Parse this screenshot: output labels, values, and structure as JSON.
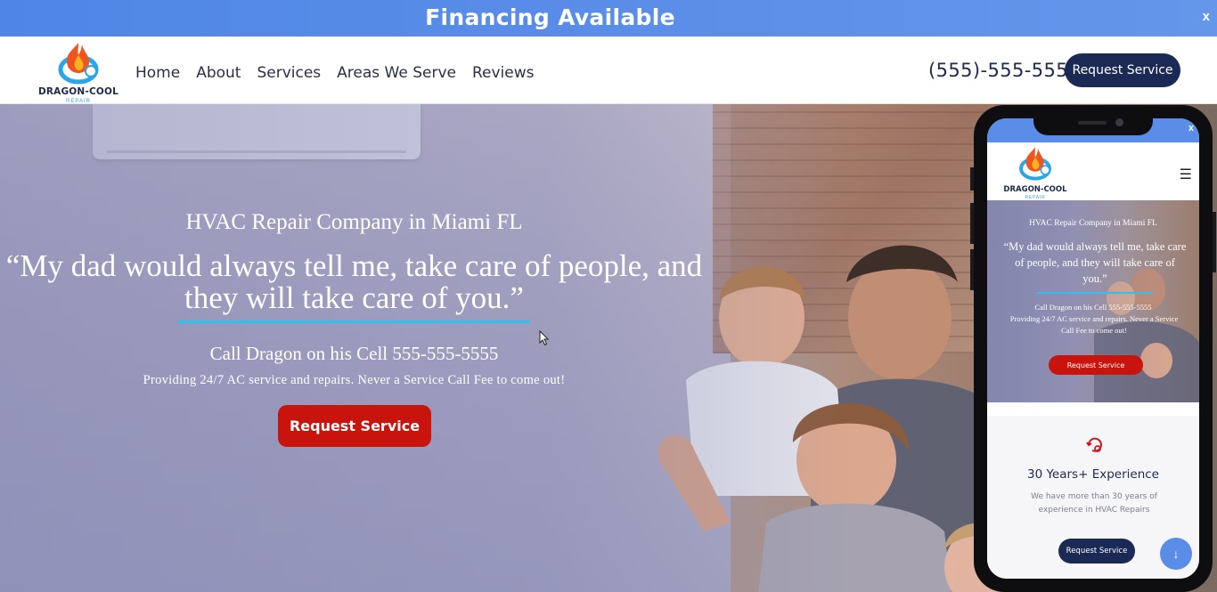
{
  "banner": {
    "text": "Financing Available",
    "close_label": "x"
  },
  "header": {
    "logo": {
      "name": "DRAGON-COOL",
      "sub": "REPAIR"
    },
    "nav": [
      "Home",
      "About",
      "Services",
      "Areas We Serve",
      "Reviews"
    ],
    "phone": "(555)-555-555",
    "request_button": "Request Service"
  },
  "hero": {
    "subtitle": "HVAC Repair Company in Miami FL",
    "quote": "“My dad would always tell me, take care of people, and they will take care of you.”",
    "call": "Call Dragon on his Cell 555-555-5555",
    "providing": "Providing 24/7 AC service and repairs. Never a Service Call Fee to come out!",
    "button": "Request Service"
  },
  "mobile": {
    "banner_close": "x",
    "logo": {
      "name": "DRAGON-COOL",
      "sub": "REPAIR"
    },
    "menu_icon": "hamburger-icon",
    "hero": {
      "subtitle": "HVAC Repair Company in Miami FL",
      "quote": "“My dad would always tell me, take care of people, and they will take care of you.”",
      "call": "Call Dragon on his Cell 555-555-5555",
      "providing": "Providing 24/7 AC service and repairs. Never a Service Call Fee to come out!",
      "button": "Request Service"
    },
    "feature": {
      "icon": "gear-refresh-icon",
      "title": "30 Years+ Experience",
      "text": "We have more than 30 years of experience in HVAC Repairs"
    },
    "request_button": "Request Service",
    "scroll_icon": "arrow-down-icon"
  },
  "colors": {
    "banner": "#5a8de8",
    "navy": "#1a2a55",
    "red": "#c8140d",
    "accent_line": "#2ec0ee"
  }
}
